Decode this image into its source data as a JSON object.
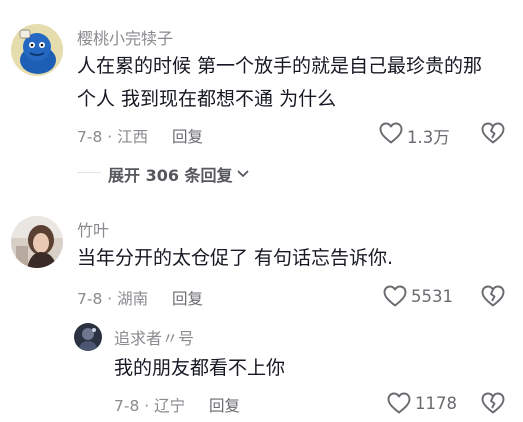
{
  "comments": [
    {
      "username": "樱桃小完犊子",
      "text_line1": "人在累的时候 第一个放手的就是自己最珍贵的那",
      "text_line2": "个人 我到现在都想不通 为什么",
      "date": "7-8",
      "location": "江西",
      "reply_label": "回复",
      "likes": "1.3万",
      "expand_label": "展开 306 条回复"
    },
    {
      "username": "竹叶",
      "text": "当年分开的太仓促了 有句话忘告诉你.",
      "date": "7-8",
      "location": "湖南",
      "reply_label": "回复",
      "likes": "5531"
    }
  ],
  "reply": {
    "username": "追求者〃号",
    "text": "我的朋友都看不上你",
    "date": "7-8",
    "location": "辽宁",
    "reply_label": "回复",
    "likes": "1178"
  },
  "colors": {
    "text": "#161823",
    "secondary": "#8a8a8f",
    "avatar1": "#1d5fb5",
    "avatar1_bg": "#e9e2b3"
  },
  "icons": [
    "heart-icon",
    "broken-heart-icon",
    "chevron-down-icon"
  ]
}
